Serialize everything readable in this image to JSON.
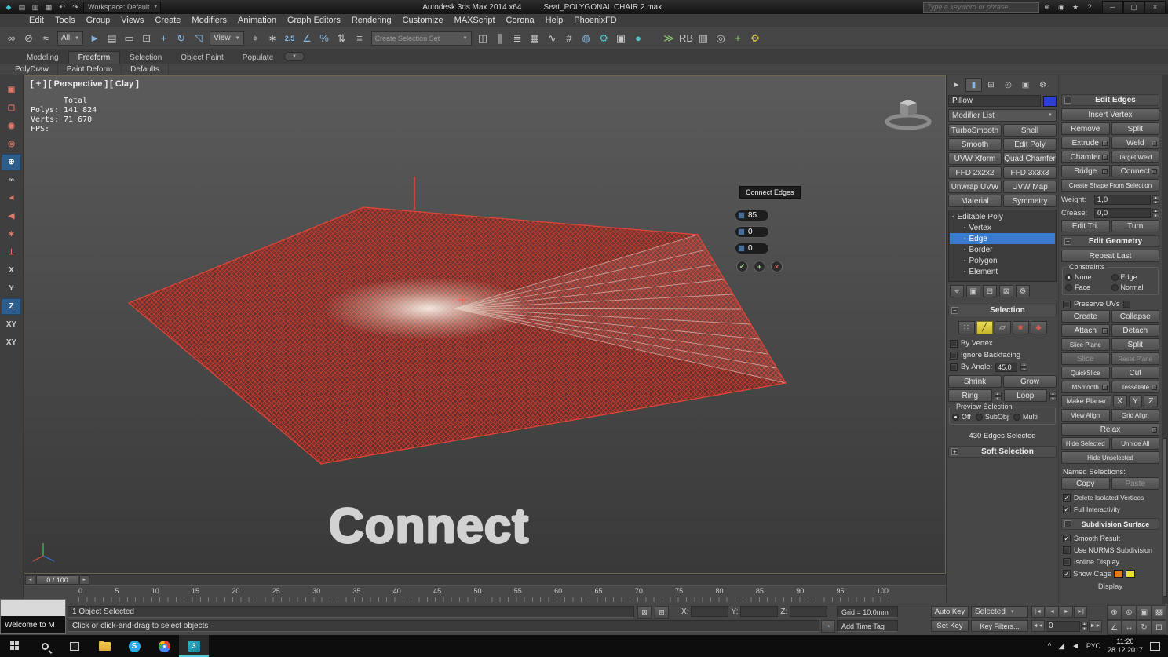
{
  "colors": {
    "wire_red": "#cf3b30",
    "selection_blue": "#3a7bd0",
    "subobj_yellow": "#d8c838",
    "object_swatch": "#2b3fd4",
    "cage_orange": "#e07b18",
    "cage_yellow": "#e8df3a"
  },
  "titlebar": {
    "app_name": "Autodesk 3ds Max 2014 x64",
    "file_name": "Seat_POLYGONAL CHAIR 2.max",
    "workspace": "Workspace: Default",
    "search_placeholder": "Type a keyword or phrase",
    "quick_icons": [
      {
        "name": "max-logo-icon",
        "glyph": "◆",
        "cls": "c-teal"
      },
      {
        "name": "new-scene-icon",
        "glyph": "▤"
      },
      {
        "name": "open-file-icon",
        "glyph": "▥"
      },
      {
        "name": "save-file-icon",
        "glyph": "▦"
      },
      {
        "name": "undo-icon",
        "glyph": "↶"
      },
      {
        "name": "redo-icon",
        "glyph": "↷"
      }
    ],
    "info_icons": [
      {
        "name": "search-go-icon",
        "glyph": "⊕"
      },
      {
        "name": "communication-center-icon",
        "glyph": "◉"
      },
      {
        "name": "favorites-star-icon",
        "glyph": "★"
      },
      {
        "name": "help-icon",
        "glyph": "?"
      }
    ],
    "window_buttons": [
      {
        "name": "minimize-button",
        "glyph": "─"
      },
      {
        "name": "restore-button",
        "glyph": "▢"
      },
      {
        "name": "close-button",
        "glyph": "×"
      }
    ]
  },
  "menubar": {
    "items": [
      "Edit",
      "Tools",
      "Group",
      "Views",
      "Create",
      "Modifiers",
      "Animation",
      "Graph Editors",
      "Rendering",
      "Customize",
      "MAXScript",
      "Corona",
      "Help",
      "PhoenixFD"
    ]
  },
  "toolbar": {
    "group1": [
      {
        "name": "select-and-link-icon",
        "glyph": "∞"
      },
      {
        "name": "unlink-selection-icon",
        "glyph": "⊘"
      },
      {
        "name": "bind-to-space-warp-icon",
        "glyph": "≈"
      }
    ],
    "selection_filter": "All",
    "group2": [
      {
        "name": "select-object-icon",
        "glyph": "►",
        "cls": "c-blue"
      },
      {
        "name": "select-by-name-icon",
        "glyph": "▤"
      },
      {
        "name": "rectangular-selection-region-icon",
        "glyph": "▭"
      },
      {
        "name": "window-crossing-icon",
        "glyph": "⊡"
      },
      {
        "name": "select-and-move-icon",
        "glyph": "+",
        "cls": "c-blue"
      },
      {
        "name": "select-and-rotate-icon",
        "glyph": "↻",
        "cls": "c-blue"
      },
      {
        "name": "select-and-scale-icon",
        "glyph": "◹",
        "cls": "c-blue"
      }
    ],
    "coord_system": "View",
    "group3": [
      {
        "name": "use-pivot-point-icon",
        "glyph": "⌖"
      },
      {
        "name": "select-and-manipulate-icon",
        "glyph": "∗"
      },
      {
        "name": "snaps-toggle-icon",
        "glyph": "2.5",
        "cls": "c-blue txt"
      },
      {
        "name": "angle-snap-icon",
        "glyph": "∠",
        "cls": "c-blue"
      },
      {
        "name": "percent-snap-icon",
        "glyph": "%",
        "cls": "c-blue"
      },
      {
        "name": "spinner-snap-icon",
        "glyph": "⇅"
      }
    ],
    "group4": [
      {
        "name": "edit-named-selection-sets-icon",
        "glyph": "≡"
      }
    ],
    "named_set_placeholder": "Create Selection Set",
    "group5": [
      {
        "name": "mirror-icon",
        "glyph": "◫"
      },
      {
        "name": "align-icon",
        "glyph": "∥"
      },
      {
        "name": "layer-manager-icon",
        "glyph": "≣"
      },
      {
        "name": "ribbon-toggle-icon",
        "glyph": "▦"
      },
      {
        "name": "curve-editor-icon",
        "glyph": "∿"
      },
      {
        "name": "schematic-view-icon",
        "glyph": "#"
      },
      {
        "name": "material-editor-icon",
        "glyph": "◍",
        "cls": "c-blue"
      },
      {
        "name": "render-setup-icon",
        "glyph": "⚙",
        "cls": "c-teal"
      },
      {
        "name": "rendered-frame-icon",
        "glyph": "▣"
      },
      {
        "name": "render-production-icon",
        "glyph": "●",
        "cls": "c-teal"
      }
    ],
    "group6": [
      {
        "name": "corona-toolbar-icon",
        "glyph": "≫",
        "cls": "c-green"
      },
      {
        "name": "rb-plugin-icon",
        "glyph": "RB",
        "cls": "badge"
      },
      {
        "name": "frame-buffer-icon",
        "glyph": "▥"
      },
      {
        "name": "lightmix-icon",
        "glyph": "◎"
      },
      {
        "name": "add-plugin-icon",
        "glyph": "+",
        "cls": "c-green"
      },
      {
        "name": "phoenix-settings-icon",
        "glyph": "⚙",
        "cls": "c-yellow"
      }
    ]
  },
  "ribbon": {
    "tabs": [
      {
        "label": "Modeling"
      },
      {
        "label": "Freeform",
        "cls": "active"
      },
      {
        "label": "Selection"
      },
      {
        "label": "Object Paint"
      },
      {
        "label": "Populate"
      }
    ],
    "min_glyph": "▼",
    "panels": [
      "PolyDraw",
      "Paint Deform",
      "Defaults"
    ]
  },
  "left_toolbar": {
    "items": [
      {
        "name": "macro-button-1",
        "glyph": "▣",
        "cls": "c-red"
      },
      {
        "name": "macro-button-2",
        "glyph": "▢",
        "cls": "c-red"
      },
      {
        "name": "macro-button-3",
        "glyph": "◉",
        "cls": "c-red"
      },
      {
        "name": "macro-button-4",
        "glyph": "◎",
        "cls": "c-red"
      },
      {
        "name": "macro-button-5",
        "glyph": "⊕",
        "cls": "c-blue active"
      },
      {
        "name": "macro-button-6",
        "glyph": "∞"
      },
      {
        "name": "macro-button-7",
        "glyph": "◄",
        "cls": "c-red"
      },
      {
        "name": "macro-button-8",
        "glyph": "◀",
        "cls": "c-red"
      },
      {
        "name": "macro-button-9",
        "glyph": "∗",
        "cls": "c-red"
      },
      {
        "name": "macro-button-10",
        "glyph": "⊥",
        "cls": "c-red"
      },
      {
        "name": "axis-x-button",
        "glyph": "X"
      },
      {
        "name": "axis-y-button",
        "glyph": "Y"
      },
      {
        "name": "axis-z-button",
        "glyph": "Z",
        "cls": "active"
      },
      {
        "name": "axis-xy-button",
        "glyph": "XY"
      },
      {
        "name": "axis-xy2-button",
        "glyph": "XY"
      }
    ]
  },
  "viewport": {
    "label": "[ + ] [ Perspective ] [ Clay ]",
    "stats": {
      "rows": [
        {
          "label": "",
          "value": "Total"
        },
        {
          "label": "Polys:",
          "value": "141 824"
        },
        {
          "label": "Verts:",
          "value": "71 670"
        },
        {
          "label": "",
          "value": ""
        },
        {
          "label": "FPS:",
          "value": ""
        }
      ]
    },
    "caption": "Connect",
    "caddy": {
      "tooltip": "Connect Edges",
      "rows": [
        {
          "name": "connect-segments-field",
          "value": "85"
        },
        {
          "name": "connect-pinch-field",
          "value": "0"
        },
        {
          "name": "connect-slide-field",
          "value": "0"
        }
      ],
      "buttons": [
        {
          "name": "caddy-ok-button",
          "glyph": "✓",
          "cls": "ok"
        },
        {
          "name": "caddy-apply-button",
          "glyph": "+",
          "cls": "ok"
        },
        {
          "name": "caddy-cancel-button",
          "glyph": "×",
          "cls": "cancel"
        }
      ]
    }
  },
  "timeline": {
    "prev_label": "◄",
    "next_label": "►",
    "slider_value": "0 / 100",
    "ticks": [
      "0",
      "5",
      "10",
      "15",
      "20",
      "25",
      "30",
      "35",
      "40",
      "45",
      "50",
      "55",
      "60",
      "65",
      "70",
      "75",
      "80",
      "85",
      "90",
      "95",
      "100"
    ]
  },
  "status": {
    "welcome_title": "Welcome to M",
    "selected_info": "1 Object Selected",
    "prompt": "Click or click-and-drag to select objects",
    "x_label": "X:",
    "y_label": "Y:",
    "z_label": "Z:",
    "grid_value": "Grid = 10,0mm",
    "time_tag": "Add Time Tag",
    "auto_key": "Auto Key",
    "selected_mode": "Selected",
    "set_key": "Set Key",
    "key_filters": "Key Filters...",
    "frame_value": "0",
    "transport1": [
      {
        "name": "go-to-start-button",
        "glyph": "|◄"
      },
      {
        "name": "prev-frame-button",
        "glyph": "◄"
      },
      {
        "name": "play-button",
        "glyph": "►"
      },
      {
        "name": "go-to-end-button",
        "glyph": "►|"
      }
    ],
    "transport2_prev": {
      "name": "prev-key-button",
      "glyph": "◄◄"
    },
    "transport2_next": {
      "name": "next-key-button",
      "glyph": "►►"
    },
    "nav_icons": [
      {
        "name": "zoom-icon",
        "glyph": "⊕"
      },
      {
        "name": "zoom-all-icon",
        "glyph": "⊚"
      },
      {
        "name": "zoom-extents-icon",
        "glyph": "▣"
      },
      {
        "name": "zoom-extents-all-icon",
        "glyph": "▩"
      },
      {
        "name": "field-of-view-icon",
        "glyph": "∠"
      },
      {
        "name": "pan-icon",
        "glyph": "↔"
      },
      {
        "name": "orbit-icon",
        "glyph": "↻"
      },
      {
        "name": "maximize-viewport-icon",
        "glyph": "⊡"
      }
    ]
  },
  "command_panel": {
    "tabs": [
      {
        "name": "tab-create",
        "glyph": "►"
      },
      {
        "name": "tab-modify",
        "glyph": "▮",
        "cls": "active c-blue"
      },
      {
        "name": "tab-hierarchy",
        "glyph": "⊞"
      },
      {
        "name": "tab-motion",
        "glyph": "◎"
      },
      {
        "name": "tab-display",
        "glyph": "▣"
      },
      {
        "name": "tab-utilities",
        "glyph": "⚙"
      }
    ],
    "object_name": "Pillow",
    "object_color_style": "background:#2b3fd4",
    "modifier_list_label": "Modifier List",
    "modifier_buttons": [
      "TurboSmooth",
      "Shell",
      "Smooth",
      "Edit Poly",
      "UVW Xform",
      "Quad Chamfer",
      "FFD 2x2x2",
      "FFD 3x3x3",
      "Unwrap UVW",
      "UVW Map",
      "Material",
      "Symmetry"
    ],
    "stack": [
      {
        "label": "Editable Poly",
        "cls": "root"
      },
      {
        "label": "Vertex",
        "cls": "child"
      },
      {
        "label": "Edge",
        "cls": "child selected"
      },
      {
        "label": "Border",
        "cls": "child"
      },
      {
        "label": "Polygon",
        "cls": "child"
      },
      {
        "label": "Element",
        "cls": "child"
      }
    ],
    "stack_tools": [
      {
        "name": "pin-stack-icon",
        "glyph": "⌖"
      },
      {
        "name": "show-end-result-icon",
        "glyph": "▣"
      },
      {
        "name": "make-unique-icon",
        "glyph": "⊟"
      },
      {
        "name": "remove-modifier-icon",
        "glyph": "⊠"
      },
      {
        "name": "configure-modifier-sets-icon",
        "glyph": "⚙"
      }
    ],
    "selection": {
      "title": "Selection",
      "subobj": [
        {
          "name": "vertex-mode-icon",
          "glyph": "∷"
        },
        {
          "name": "edge-mode-icon",
          "glyph": "╱",
          "cls": "active"
        },
        {
          "name": "border-mode-icon",
          "glyph": "▱"
        },
        {
          "name": "polygon-mode-icon",
          "glyph": "■",
          "cls": "c-red"
        },
        {
          "name": "element-mode-icon",
          "glyph": "◆",
          "cls": "c-red"
        }
      ],
      "checks": [
        {
          "label": "By Vertex"
        },
        {
          "label": "Ignore Backfacing"
        }
      ],
      "by_angle_label": "By Angle:",
      "by_angle_value": "45,0",
      "shrink_label": "Shrink",
      "grow_label": "Grow",
      "ring_label": "Ring",
      "loop_label": "Loop",
      "preview_title": "Preview Selection",
      "preview_options": [
        {
          "label": "Off",
          "cls": "on"
        },
        {
          "label": "SubObj"
        },
        {
          "label": "Multi"
        }
      ],
      "status": "430 Edges Selected"
    },
    "soft_selection_title": "Soft Selection"
  },
  "edit_edges": {
    "title": "Edit Edges",
    "buttons": [
      {
        "label": "Insert Vertex",
        "cls": "full"
      },
      {
        "label": "Remove",
        "cls": "half"
      },
      {
        "label": "Split",
        "cls": "half"
      },
      {
        "label": "Extrude",
        "cls": "half box"
      },
      {
        "label": "Weld",
        "cls": "half box"
      },
      {
        "label": "Chamfer",
        "cls": "half box"
      },
      {
        "label": "Target Weld",
        "cls": "half tiny"
      },
      {
        "label": "Bridge",
        "cls": "half box"
      },
      {
        "label": "Connect",
        "cls": "half box"
      },
      {
        "label": "Create Shape From Selection",
        "cls": "full tiny"
      }
    ],
    "spinners": [
      {
        "label": "Weight:",
        "value": "1,0"
      },
      {
        "label": "Crease:",
        "value": "0,0"
      }
    ],
    "buttons2": [
      {
        "label": "Edit Tri.",
        "cls": "half"
      },
      {
        "label": "Turn",
        "cls": "half"
      }
    ]
  },
  "edit_geometry": {
    "title": "Edit Geometry",
    "repeat_last": "Repeat Last",
    "constraints": {
      "title": "Constraints",
      "options": [
        {
          "label": "None",
          "cls": "on"
        },
        {
          "label": "Edge"
        },
        {
          "label": "Face"
        },
        {
          "label": "Normal"
        }
      ]
    },
    "preserve_uvs_label": "Preserve UVs",
    "buttons": [
      {
        "label": "Create",
        "cls": "half"
      },
      {
        "label": "Collapse",
        "cls": "half"
      },
      {
        "label": "Attach",
        "cls": "half box"
      },
      {
        "label": "Detach",
        "cls": "half"
      },
      {
        "label": "Slice Plane",
        "cls": "half tiny"
      },
      {
        "label": "Split",
        "cls": "half"
      },
      {
        "label": "Slice",
        "cls": "half disabled"
      },
      {
        "label": "Reset Plane",
        "cls": "half disabled tiny"
      },
      {
        "label": "QuickSlice",
        "cls": "half tiny"
      },
      {
        "label": "Cut",
        "cls": "half"
      },
      {
        "label": "MSmooth",
        "cls": "half box tiny"
      },
      {
        "label": "Tessellate",
        "cls": "half box tiny"
      },
      {
        "label": "Make Planar",
        "cls": "mp tiny"
      },
      {
        "label": "X",
        "cls": "xyz"
      },
      {
        "label": "Y",
        "cls": "xyz"
      },
      {
        "label": "Z",
        "cls": "xyz"
      },
      {
        "label": "View Align",
        "cls": "half tiny"
      },
      {
        "label": "Grid Align",
        "cls": "half tiny"
      },
      {
        "label": "Relax",
        "cls": "full box"
      },
      {
        "label": "Hide Selected",
        "cls": "half tiny"
      },
      {
        "label": "Unhide All",
        "cls": "half tiny"
      },
      {
        "label": "Hide Unselected",
        "cls": "full tiny"
      }
    ],
    "named_label": "Named Selections:",
    "named_buttons": [
      {
        "label": "Copy",
        "cls": "half"
      },
      {
        "label": "Paste",
        "cls": "half disabled"
      }
    ],
    "checks": [
      {
        "label": "Delete Isolated Vertices",
        "cls": "checked"
      },
      {
        "label": "Full Interactivity",
        "cls": "checked"
      }
    ]
  },
  "subdivision": {
    "title": "Subdivision Surface",
    "checks": [
      {
        "label": "Smooth Result",
        "cls": "checked"
      },
      {
        "label": "Use NURMS Subdivision"
      },
      {
        "label": "Isoline Display"
      }
    ],
    "show_cage_label": "Show Cage",
    "cage_swatch1_style": "background:#e07b18",
    "cage_swatch2_style": "background:#e8df3a",
    "partial_label": "Display"
  },
  "taskbar": {
    "lang": "РУС",
    "time": "11:20",
    "date": "28.12.2017"
  }
}
